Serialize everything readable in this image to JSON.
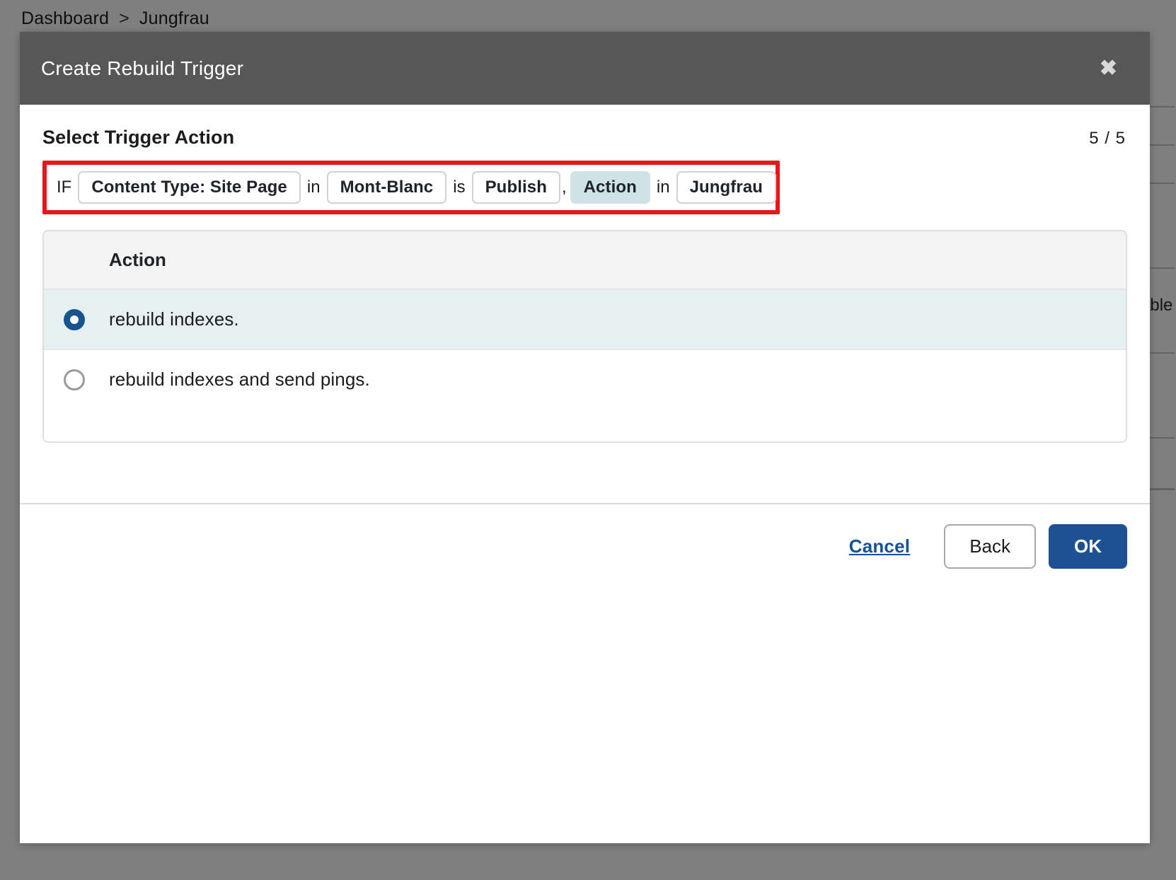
{
  "background": {
    "breadcrumb": {
      "items": [
        "Dashboard",
        "Jungfrau"
      ],
      "separator": ">"
    },
    "partial_cell_text": "able"
  },
  "dialog": {
    "title": "Create Rebuild Trigger",
    "close_icon": "close-icon",
    "close_glyph": "✖",
    "section_title": "Select Trigger Action",
    "step_counter": "5 / 5",
    "condition": {
      "if_label": "IF",
      "in_label_1": "in",
      "is_label": "is",
      "comma_label": ",",
      "in_label_2": "in",
      "pills": [
        {
          "label": "Content Type: Site Page",
          "active": false
        },
        {
          "label": "Mont-Blanc",
          "active": false
        },
        {
          "label": "Publish",
          "active": false
        },
        {
          "label": "Action",
          "active": true
        },
        {
          "label": "Jungfrau",
          "active": false
        }
      ]
    },
    "table": {
      "column_header": "Action",
      "rows": [
        {
          "label": "rebuild indexes.",
          "selected": true
        },
        {
          "label": "rebuild indexes and send pings.",
          "selected": false
        }
      ]
    },
    "footer": {
      "cancel_label": "Cancel",
      "back_label": "Back",
      "ok_label": "OK"
    }
  },
  "colors": {
    "accent_blue": "#1d5193",
    "link_blue": "#14539a",
    "highlight_red": "#e8161a",
    "active_pill_bg": "#cfe2e6",
    "selected_row_bg": "#e6f0f0",
    "header_gray": "#575757",
    "scrim": "rgba(0,0,0,0.5)"
  }
}
